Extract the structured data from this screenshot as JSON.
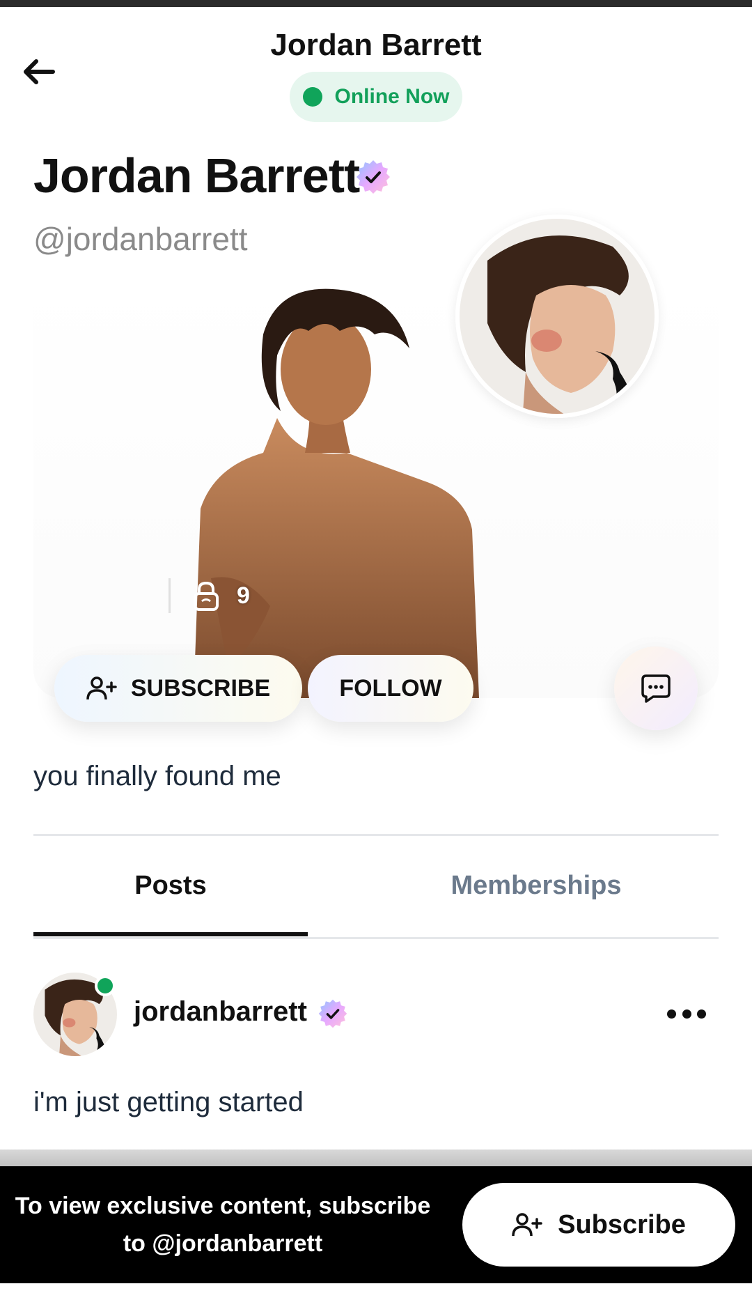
{
  "header": {
    "title": "Jordan Barrett",
    "status_label": "Online Now",
    "status_color": "#12a05a"
  },
  "profile": {
    "name": "Jordan Barrett",
    "handle": "@jordanbarrett",
    "locked_count": "9",
    "bio": "you finally found me"
  },
  "actions": {
    "subscribe_label": "SUBSCRIBE",
    "follow_label": "FOLLOW"
  },
  "tabs": [
    {
      "label": "Posts",
      "active": true
    },
    {
      "label": "Memberships",
      "active": false
    }
  ],
  "post": {
    "username": "jordanbarrett",
    "text": "i'm just getting started"
  },
  "bottom_banner": {
    "message": "To view exclusive content, subscribe to @jordanbarrett",
    "button_label": "Subscribe"
  },
  "icons": {
    "back": "arrow-left-icon",
    "verified": "verified-badge-icon",
    "lock": "lock-icon",
    "add_user": "add-user-icon",
    "chat": "chat-bubble-icon",
    "more": "more-dots-icon"
  }
}
